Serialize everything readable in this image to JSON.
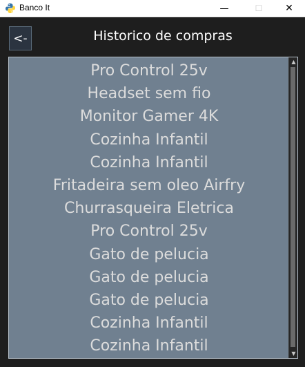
{
  "window": {
    "title": "Banco It",
    "minimize_glyph": "—",
    "maximize_glyph": "☐",
    "close_glyph": "✕",
    "icon": "python-icon"
  },
  "header": {
    "back_label": "<-",
    "title": "Historico de compras"
  },
  "purchases": [
    "Pro Control 25v",
    "Headset sem fio",
    "Monitor Gamer 4K",
    "Cozinha Infantil",
    "Cozinha Infantil",
    "Fritadeira sem oleo Airfry",
    "Churrasqueira Eletrica",
    "Pro Control 25v",
    "Gato de pelucia",
    "Gato de pelucia",
    "Gato de pelucia",
    "Cozinha Infantil",
    "Cozinha Infantil"
  ],
  "scrollbar": {
    "up_glyph": "▲",
    "down_glyph": "▼"
  },
  "colors": {
    "background": "#1e1e1e",
    "list_background": "#708090",
    "list_text": "#dcdcdc",
    "header_text": "#ffffff"
  }
}
